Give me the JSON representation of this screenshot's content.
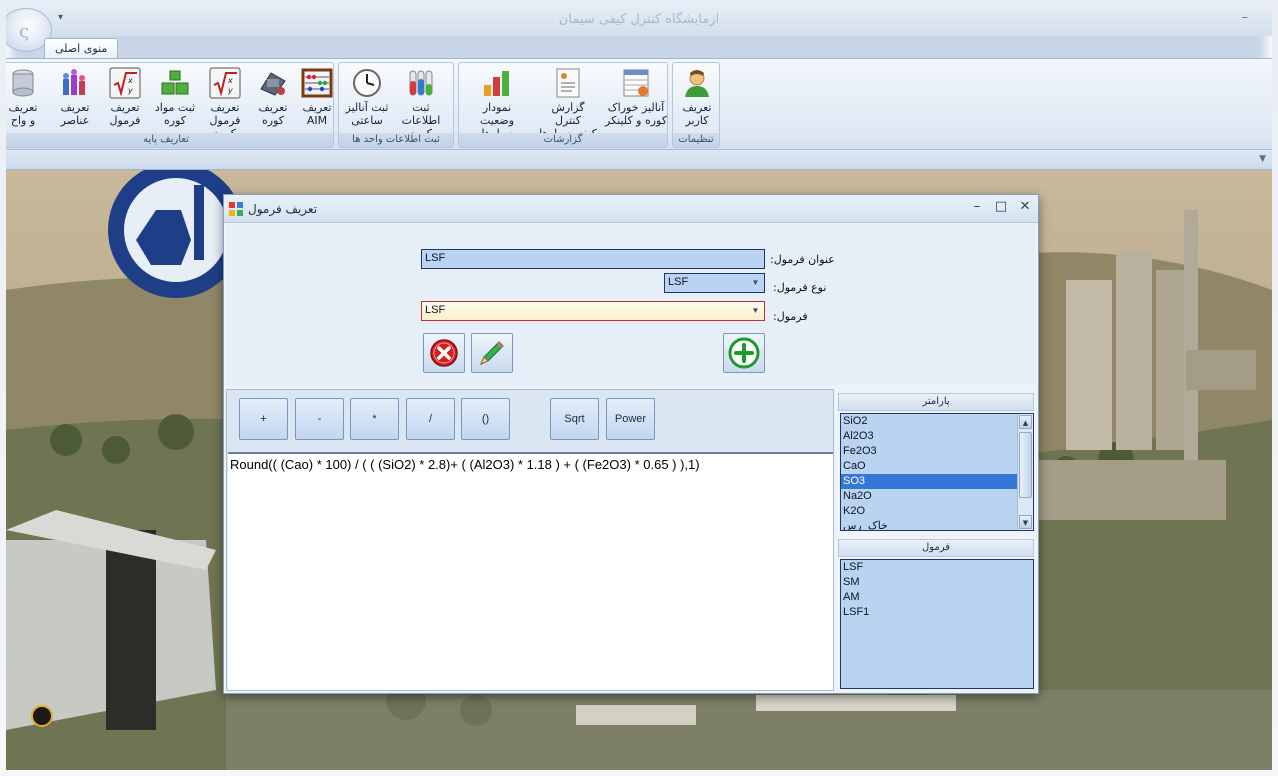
{
  "app": {
    "title": "ازمایشگاه کنترل کیفی سیمان",
    "qat_arrow": "▾",
    "minimize": "–"
  },
  "ribbon": {
    "tab": "منوی اصلی",
    "groups": {
      "settings": "تنظیمات",
      "reports": "گزارشات",
      "kiln_unit": "ثبت اطلاعات واحد ها",
      "base": "تعاریف پایه"
    },
    "buttons": {
      "define_user": "تعریف\nکاربر",
      "raw_feed_analysis": "آنالیز خوراک\nکوره و کلینکر",
      "silo_quality_report": "گزارش کنترل\nکیفی سیلوها",
      "silo_status_chart": "نمودار وضعیت\nسیلوها",
      "kiln_info": "ثبت اطلاعات\nکوره",
      "hourly_analysis": "ثبت آنالیز\nساعتی",
      "define_aim": "تعریف\nAIM",
      "define_kiln": "تعریف\nکوره",
      "kiln_formula": "تعریف\nفرمول کوره",
      "kiln_materials": "ثبت مواد\nکوره",
      "define_formula": "تعریف\nفرمول",
      "define_elements": "تعریف\nعناصر",
      "define_units": "تعریف\nو واح"
    }
  },
  "dialog": {
    "title": "تعریف فرمول",
    "controls": {
      "minimize": "–",
      "maximize": "□",
      "close": "✕"
    },
    "fields": {
      "formula_title_label": "عنوان فرمول:",
      "formula_title_value": "LSF",
      "formula_type_label": "نوع فرمول:",
      "formula_type_value": "LSF",
      "formula_label": "فرمول:",
      "formula_value": "LSF"
    },
    "operators": [
      "+",
      "-",
      "*",
      "/",
      "()",
      "Sqrt",
      "Power"
    ],
    "expression": "Round(( (Cao) * 100) / ( ( (SiO2) * 2.8)+ (  (Al2O3) * 1.18 ) + (  (Fe2O3) * 0.65 ) ),1)",
    "parameters": {
      "header": "پارامتر",
      "items": [
        "SiO2",
        "Al2O3",
        "Fe2O3",
        "CaO",
        "SO3",
        "Na2O",
        "K2O",
        "خاک_رس"
      ],
      "selected_index": 4
    },
    "formulas": {
      "header": "فرمول",
      "items": [
        "LSF",
        "SM",
        "AM",
        "LSF1"
      ]
    }
  },
  "colors": {
    "list_bg": "#b9d3f1",
    "selection": "#3477d6",
    "delete_red": "#d42020",
    "add_green": "#1b9b2c",
    "edit_green": "#1f9a3a"
  }
}
